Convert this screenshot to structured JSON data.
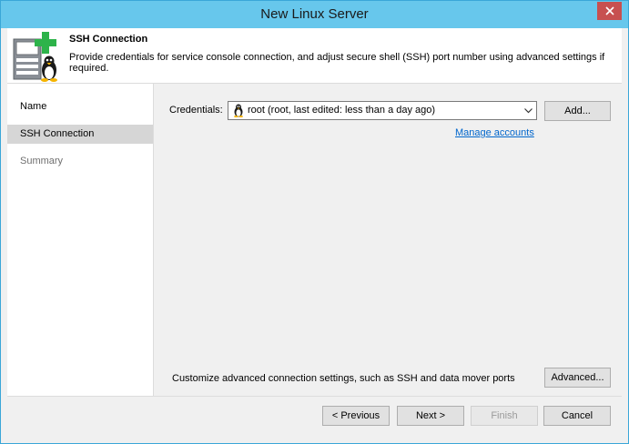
{
  "window": {
    "title": "New Linux Server",
    "close_icon": "close-icon",
    "titlebar_color": "#67c7ec",
    "close_color": "#c75050"
  },
  "header": {
    "title": "SSH Connection",
    "description": "Provide credentials for service console connection, and adjust secure shell (SSH) port number using advanced settings if required.",
    "icon": "linux-server-add-icon"
  },
  "nav": {
    "items": [
      {
        "label": "Name",
        "state": "normal"
      },
      {
        "label": "SSH Connection",
        "state": "active"
      },
      {
        "label": "Summary",
        "state": "disabled"
      }
    ]
  },
  "credentials": {
    "label": "Credentials:",
    "selected_value": "root (root, last edited: less than a day ago)",
    "icon": "penguin-icon",
    "add_button": "Add...",
    "manage_link": "Manage accounts"
  },
  "advanced": {
    "text": "Customize advanced connection settings, such as SSH and data mover ports",
    "button": "Advanced..."
  },
  "footer": {
    "previous": "< Previous",
    "next": "Next >",
    "finish": "Finish",
    "cancel": "Cancel"
  }
}
